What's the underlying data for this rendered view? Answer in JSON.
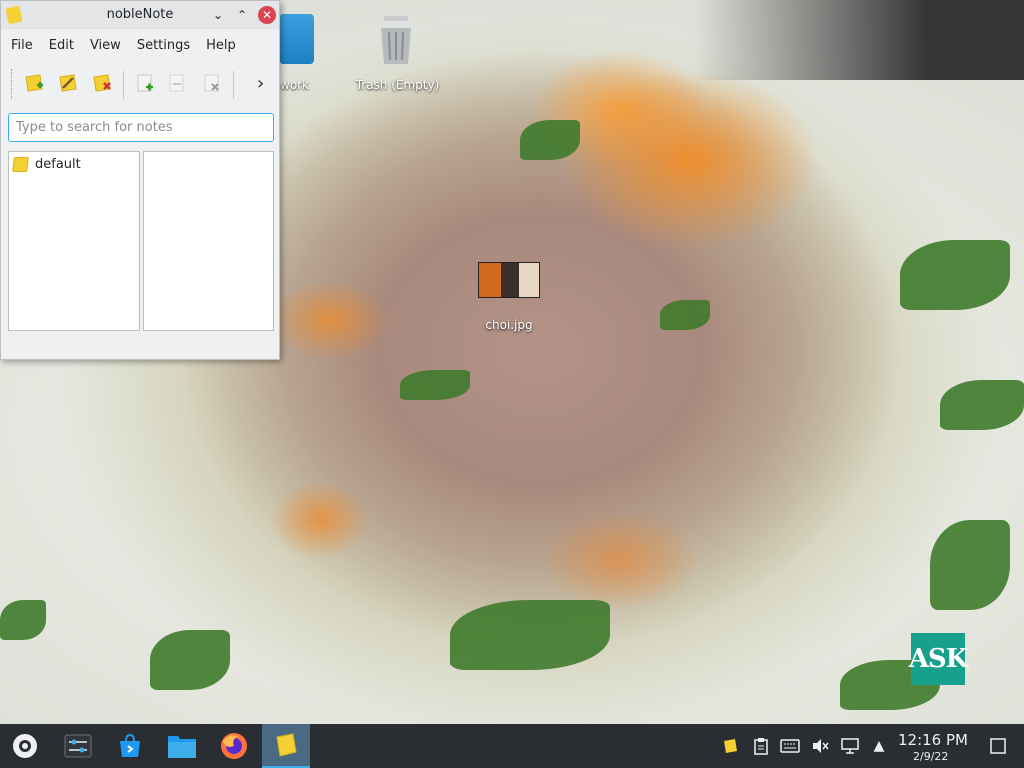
{
  "desktop": {
    "icons": [
      {
        "label": "work",
        "icon": "folder-icon"
      },
      {
        "label": "Trash (Empty)",
        "icon": "trash-icon"
      },
      {
        "label": "choi.jpg",
        "icon": "image-thumbnail"
      }
    ],
    "watermark": "ASK"
  },
  "window": {
    "title": "nobleNote",
    "menu": [
      "File",
      "Edit",
      "View",
      "Settings",
      "Help"
    ],
    "toolbar": [
      "new-folder-icon",
      "rename-folder-icon",
      "delete-folder-icon",
      "new-note-icon",
      "rename-note-icon",
      "delete-note-icon",
      "more-chevron-icon"
    ],
    "search": {
      "placeholder": "Type to search for notes",
      "value": ""
    },
    "folders": [
      "default"
    ],
    "notes": []
  },
  "taskbar": {
    "apps": [
      "application-launcher-icon",
      "system-settings-icon",
      "discover-store-icon",
      "file-manager-icon",
      "firefox-icon",
      "noblenote-icon"
    ],
    "active_app": "noblenote-icon",
    "tray": [
      "noblenote-tray-icon",
      "clipboard-icon",
      "keyboard-icon",
      "volume-muted-icon",
      "network-icon",
      "tray-expand-icon"
    ],
    "time": "12:16 PM",
    "date": "2/9/22"
  },
  "colors": {
    "accent": "#3daee9",
    "close": "#da4453",
    "taskbar": "#2a2e32",
    "watermark": "#17a08c"
  }
}
